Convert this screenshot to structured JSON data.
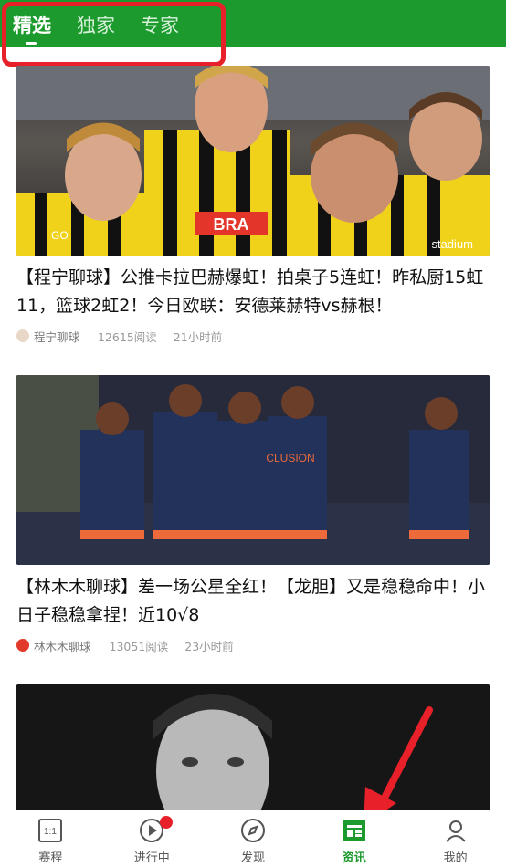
{
  "header": {
    "tabs": [
      {
        "label": "精选",
        "active": true
      },
      {
        "label": "独家",
        "active": false
      },
      {
        "label": "专家",
        "active": false
      }
    ],
    "bg_color": "#1c9a2e"
  },
  "feed": [
    {
      "title": "【程宁聊球】公推卡拉巴赫爆虹！拍桌子5连虹！昨私厨15虹11，篮球2虹2！今日欧联：安德莱赫特vs赫根！",
      "author": "程宁聊球",
      "reads": "12615阅读",
      "time": "21小时前",
      "image_labels": {
        "brand_left": "GO",
        "sponsor": "BRA",
        "right_sponsor": "stadium"
      }
    },
    {
      "title": "【林木木聊球】差一场公星全红！【龙胆】又是稳稳命中！小日子稳稳拿捏！近10√8",
      "author": "林木木聊球",
      "reads": "13051阅读",
      "time": "23小时前",
      "image_labels": {
        "sponsor": "CLUSION"
      }
    },
    {
      "title": "",
      "author": "",
      "reads": "",
      "time": "",
      "image_labels": {}
    }
  ],
  "bottom_nav": [
    {
      "label": "赛程",
      "icon": "schedule-icon",
      "icon_text": "1:1"
    },
    {
      "label": "进行中",
      "icon": "live-play-icon"
    },
    {
      "label": "发现",
      "icon": "compass-icon"
    },
    {
      "label": "资讯",
      "icon": "news-icon",
      "active": true
    },
    {
      "label": "我的",
      "icon": "profile-icon"
    }
  ],
  "colors": {
    "accent": "#1c9a2e",
    "annotation_red": "#e8202a"
  }
}
